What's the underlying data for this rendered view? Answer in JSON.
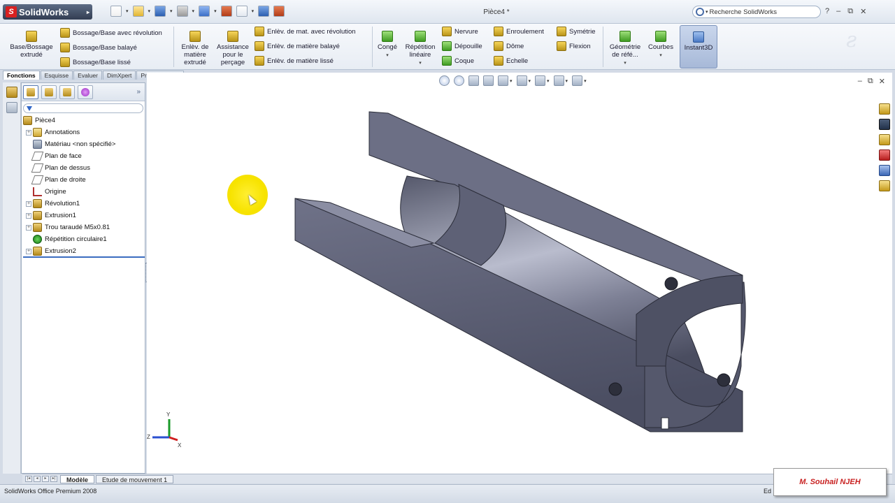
{
  "app": {
    "name": "SolidWorks",
    "logo_letter": "S",
    "doc_title": "Pièce4 *"
  },
  "search": {
    "placeholder": "Recherche SolidWorks"
  },
  "window_controls": {
    "help": "?",
    "minimize": "–",
    "restore": "⧉",
    "close": "✕"
  },
  "ribbon": {
    "base_extrude": "Base/Bossage extrudé",
    "boss_revolve": "Bossage/Base avec révolution",
    "boss_sweep": "Bossage/Base balayé",
    "boss_loft": "Bossage/Base lissé",
    "cut_extrude": "Enlèv. de matière extrudé",
    "hole_wizard": "Assistance pour le perçage",
    "cut_revolve": "Enlèv. de mat. avec révolution",
    "cut_sweep": "Enlèv. de matière balayé",
    "cut_loft": "Enlèv. de matière lissé",
    "fillet": "Congé",
    "linear_pattern": "Répétition linéaire",
    "rib": "Nervure",
    "draft": "Dépouille",
    "shell": "Coque",
    "wrap": "Enroulement",
    "dome": "Dôme",
    "scale": "Echelle",
    "mirror": "Symétrie",
    "flex": "Flexion",
    "ref_geometry": "Géométrie de réfé...",
    "curves": "Courbes",
    "instant3d": "Instant3D"
  },
  "tabs": [
    "Fonctions",
    "Esquisse",
    "Evaluer",
    "DimXpert",
    "Produits Office"
  ],
  "tree": {
    "root": "Pièce4",
    "items": [
      {
        "label": "Annotations",
        "icon": "annotation-icon",
        "expandable": true
      },
      {
        "label": "Matériau <non spécifié>",
        "icon": "material-icon",
        "expandable": false
      },
      {
        "label": "Plan de face",
        "icon": "plane-icon",
        "expandable": false
      },
      {
        "label": "Plan de dessus",
        "icon": "plane-icon",
        "expandable": false
      },
      {
        "label": "Plan de droite",
        "icon": "plane-icon",
        "expandable": false
      },
      {
        "label": "Origine",
        "icon": "origin-icon",
        "expandable": false
      },
      {
        "label": "Révolution1",
        "icon": "revolve-icon",
        "expandable": true
      },
      {
        "label": "Extrusion1",
        "icon": "extrude-icon",
        "expandable": true
      },
      {
        "label": "Trou taraudé M5x0.81",
        "icon": "hole-icon",
        "expandable": true
      },
      {
        "label": "Répétition circulaire1",
        "icon": "circular-pattern-icon",
        "expandable": false
      },
      {
        "label": "Extrusion2",
        "icon": "extrude-icon",
        "expandable": true
      }
    ]
  },
  "bottom_tabs": [
    "Modèle",
    "Etude de mouvement 1"
  ],
  "status": {
    "text": "SolidWorks Office Premium 2008",
    "right": "Ed"
  },
  "triad": {
    "x": "X",
    "y": "Y",
    "z": "Z"
  },
  "watermark": "M. Souhail NJEH",
  "colors": {
    "part_face": "#6d7086",
    "part_light": "#b4b7c9",
    "part_dark": "#3e4154",
    "highlight": "#f7e300",
    "accent": "#3a6cc0"
  }
}
